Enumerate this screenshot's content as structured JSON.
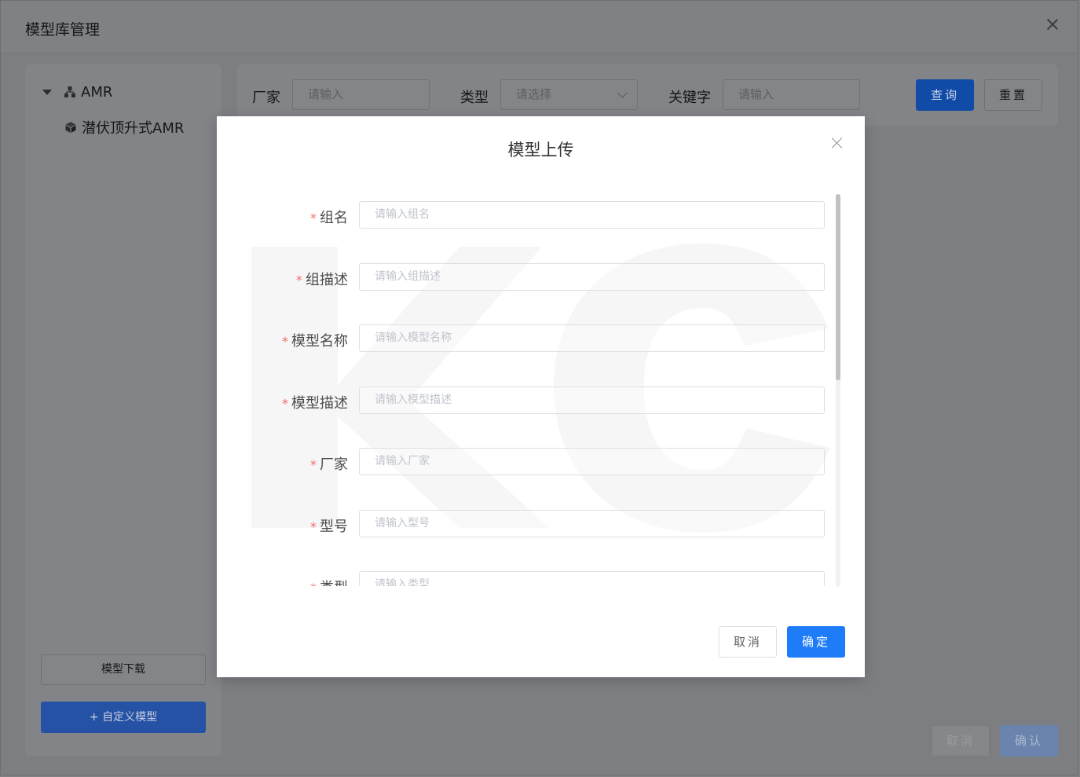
{
  "window": {
    "title": "模型库管理"
  },
  "tree": {
    "root": {
      "label": "AMR"
    },
    "child": {
      "label": "潜伏顶升式AMR"
    }
  },
  "left_buttons": {
    "download": "模型下载",
    "custom": "+ 自定义模型"
  },
  "search": {
    "vendor_label": "厂家",
    "vendor_placeholder": "请输入",
    "type_label": "类型",
    "type_placeholder": "请选择",
    "keyword_label": "关键字",
    "keyword_placeholder": "请输入",
    "query_button": "查询",
    "reset_button": "重置"
  },
  "window_footer": {
    "cancel": "取消",
    "confirm": "确认"
  },
  "modal": {
    "title": "模型上传",
    "fields": [
      {
        "label": "组名",
        "placeholder": "请输入组名"
      },
      {
        "label": "组描述",
        "placeholder": "请输入组描述"
      },
      {
        "label": "模型名称",
        "placeholder": "请输入模型名称"
      },
      {
        "label": "模型描述",
        "placeholder": "请输入模型描述"
      },
      {
        "label": "厂家",
        "placeholder": "请输入厂家"
      },
      {
        "label": "型号",
        "placeholder": "请输入型号"
      },
      {
        "label": "类型",
        "placeholder": "请输入类型"
      }
    ],
    "required_mark": "*",
    "cancel": "取消",
    "confirm": "确定",
    "watermark_text": "KC"
  },
  "colors": {
    "primary": "#1f7cf9",
    "required": "#f56c6c",
    "overlay": "#7f8084"
  },
  "icons": {
    "tree_caret": "caret-down-icon",
    "tree_root": "org-chart-icon",
    "tree_child": "cube-icon",
    "close": "close-icon",
    "select": "chevron-down-icon"
  }
}
